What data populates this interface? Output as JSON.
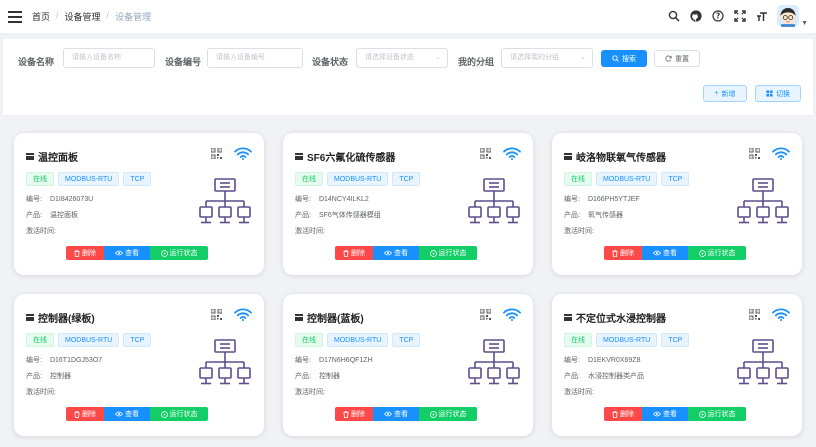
{
  "header": {
    "breadcrumbs": [
      "首页",
      "设备管理",
      "设备管理"
    ],
    "separator": "/"
  },
  "icons": [
    "menu-icon",
    "search-icon",
    "github-icon",
    "question-icon",
    "fullscreen-icon",
    "font-size-icon"
  ],
  "filter": {
    "fields": [
      {
        "label": "设备名称",
        "placeholder": "请输入设备名称"
      },
      {
        "label": "设备编号",
        "placeholder": "请输入设备编号"
      },
      {
        "label": "设备状态",
        "placeholder": "请选择设备状态"
      },
      {
        "label": "我的分组",
        "placeholder": "请选择我的分组"
      }
    ],
    "search_label": "搜索",
    "reset_label": "重置",
    "add_label": "新增",
    "switch_label": "切换"
  },
  "card_labels": {
    "serial": "编号:",
    "product": "产品:",
    "activated": "激活时间:",
    "delete": "删除",
    "view": "查看",
    "run_status": "运行状态"
  },
  "devices": [
    {
      "name": "温控面板",
      "status": "在线",
      "protocol": "MODBUS-RTU",
      "transport": "TCP",
      "serial": "D1I8426073U",
      "product": "温控面板",
      "activated": ""
    },
    {
      "name": "SF6六氟化硫传感器",
      "status": "在线",
      "protocol": "MODBUS-RTU",
      "transport": "TCP",
      "serial": "D14NCY4ILKL2",
      "product": "SF6气体传感器模组",
      "activated": ""
    },
    {
      "name": "岐洛物联氧气传感器",
      "status": "在线",
      "protocol": "MODBUS-RTU",
      "transport": "TCP",
      "serial": "D166PH5YTJEF",
      "product": "氧气传感器",
      "activated": ""
    },
    {
      "name": "控制器(绿板)",
      "status": "在线",
      "protocol": "MODBUS-RTU",
      "transport": "TCP",
      "serial": "D16T1DGJ53O7",
      "product": "控制器",
      "activated": ""
    },
    {
      "name": "控制器(蓝板)",
      "status": "在线",
      "protocol": "MODBUS-RTU",
      "transport": "TCP",
      "serial": "D17N6H6QF1ZH",
      "product": "控制器",
      "activated": ""
    },
    {
      "name": "不定位式水浸控制器",
      "status": "在线",
      "protocol": "MODBUS-RTU",
      "transport": "TCP",
      "serial": "D1EKVR0X69Z8",
      "product": "水浸控制器类产品",
      "activated": ""
    }
  ],
  "colors": {
    "primary": "#1890ff",
    "danger": "#ff4949",
    "success": "#13ce66",
    "network_icon": "#5b4f8c"
  }
}
